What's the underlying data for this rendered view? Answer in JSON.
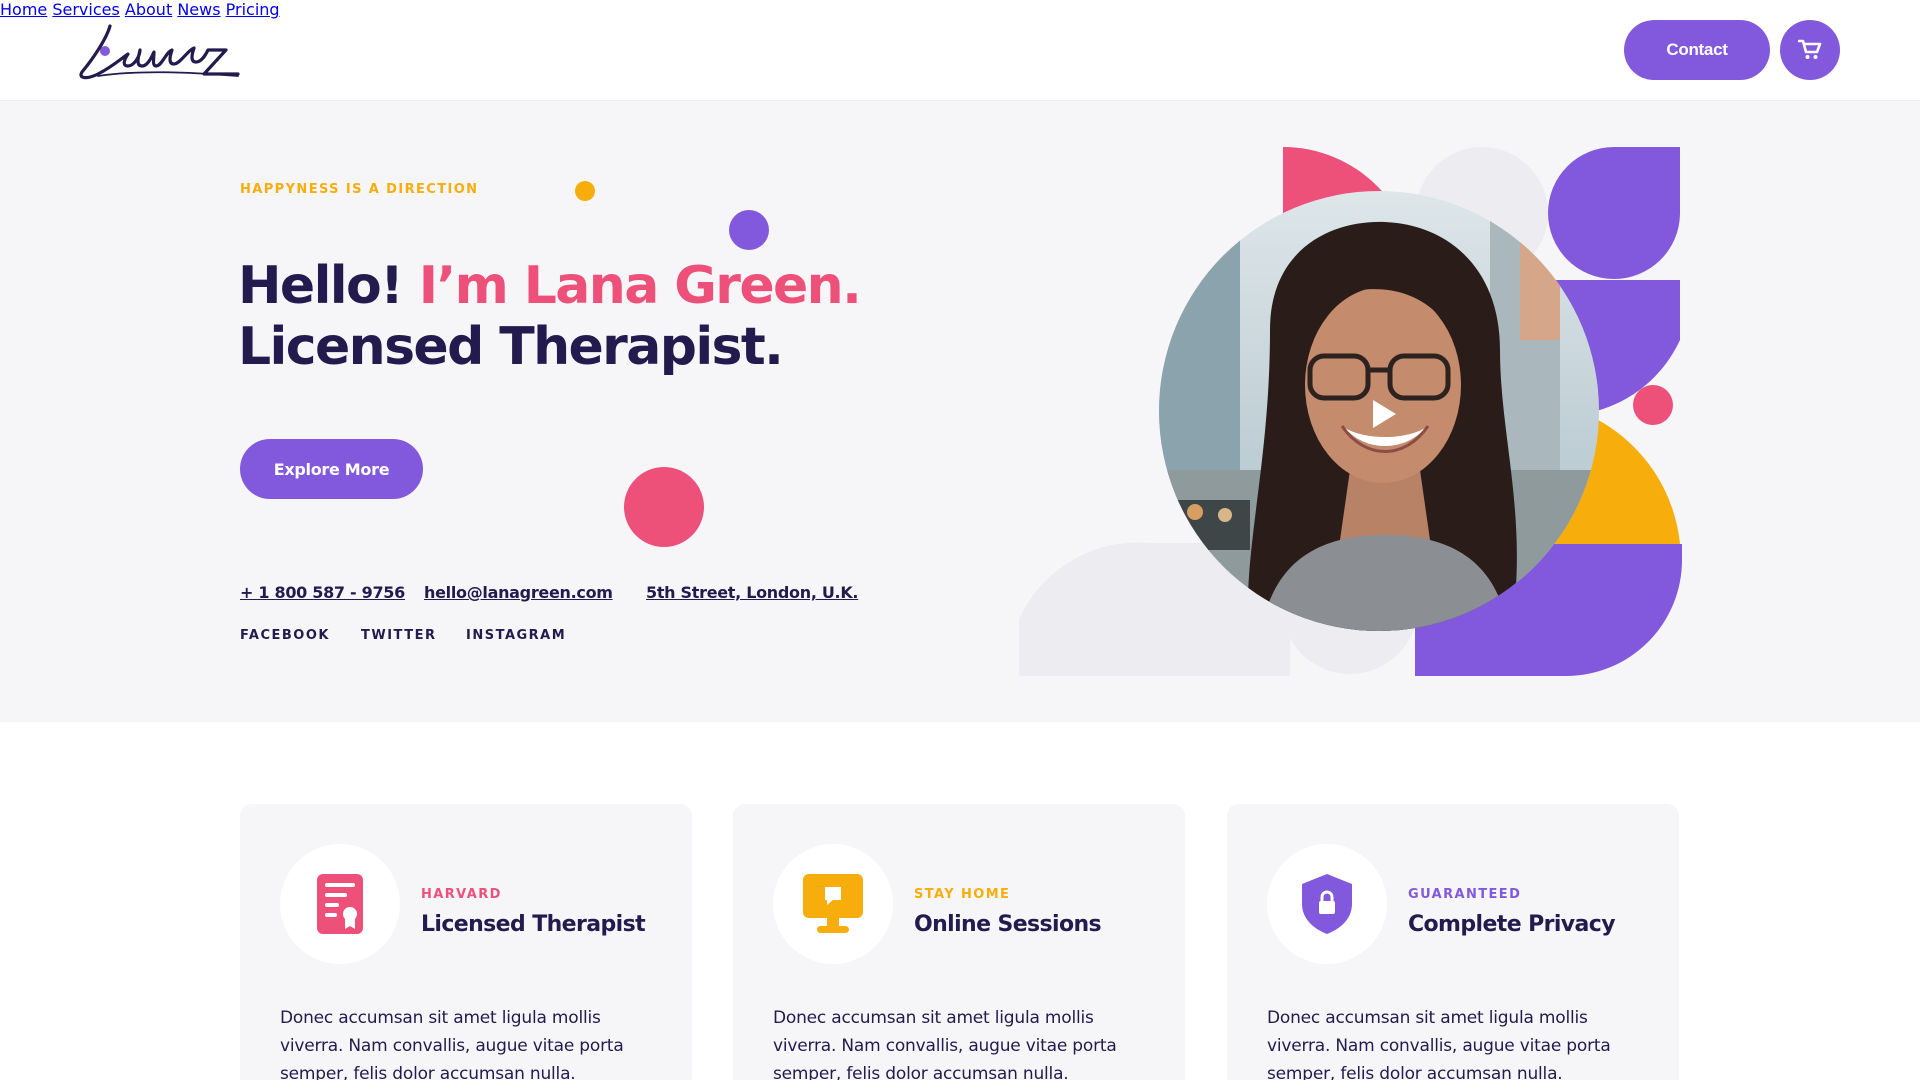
{
  "header": {
    "logo_text": "Lana",
    "nav": [
      {
        "label": "Home"
      },
      {
        "label": "Services"
      },
      {
        "label": "About"
      },
      {
        "label": "News"
      },
      {
        "label": "Pricing"
      }
    ],
    "contact_label": "Contact",
    "cart_icon": "cart-icon"
  },
  "hero": {
    "eyebrow": "HAPPYNESS IS A DIRECTION",
    "headline_part1": "Hello! ",
    "headline_highlight": "I’m Lana Green.",
    "headline_line2": "Licensed Therapist.",
    "explore_label": "Explore More",
    "phone": "+ 1 800 587 - 9756",
    "email": "hello@lanagreen.com",
    "address": "5th Street, London, U.K.",
    "social": [
      "FACEBOOK",
      "TWITTER",
      "INSTAGRAM"
    ],
    "play_icon": "play-icon"
  },
  "features": [
    {
      "eyebrow": "HARVARD",
      "title": "Licensed Therapist",
      "text": "Donec accumsan sit amet ligula mollis viverra. Nam convallis, augue vitae porta semper, felis dolor accumsan nulla.",
      "icon": "certificate-icon",
      "accent": "#ed5079"
    },
    {
      "eyebrow": "STAY HOME",
      "title": "Online Sessions",
      "text": "Donec accumsan sit amet ligula mollis viverra. Nam convallis, augue vitae porta semper, felis dolor accumsan nulla.",
      "icon": "monitor-chat-icon",
      "accent": "#f7ad0c"
    },
    {
      "eyebrow": "GUARANTEED",
      "title": "Complete Privacy",
      "text": "Donec accumsan sit amet ligula mollis viverra. Nam convallis, augue vitae porta semper, felis dolor accumsan nulla.",
      "icon": "shield-lock-icon",
      "accent": "#8259dd"
    }
  ],
  "colors": {
    "primary": "#8259dd",
    "pink": "#ed5079",
    "yellow": "#f7ad0c",
    "navy": "#231a4d",
    "hero_bg": "#f6f6f9"
  }
}
